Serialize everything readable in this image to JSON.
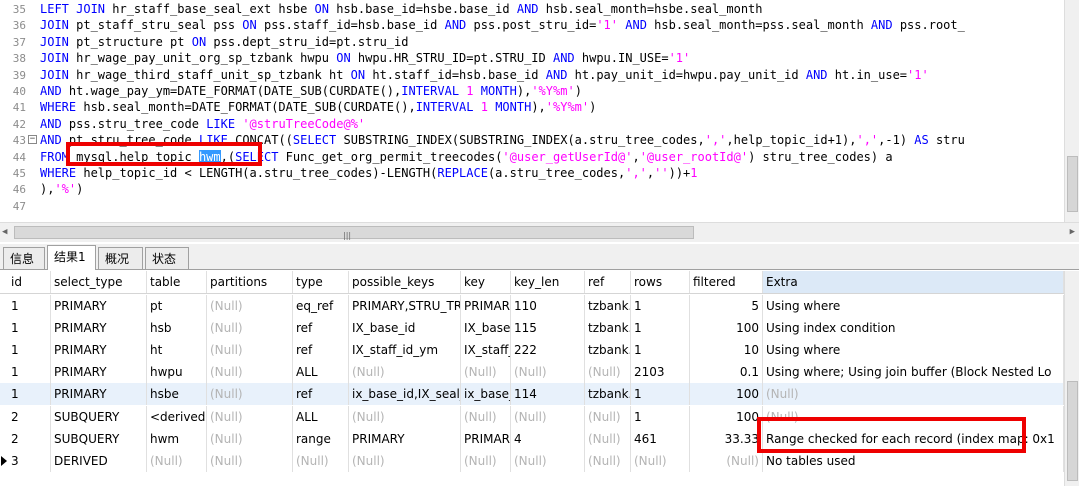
{
  "editor": {
    "lines": [
      {
        "n": "35",
        "fold": false,
        "segs": [
          {
            "t": "LEFT JOIN",
            "c": "kw"
          },
          {
            "t": " hr_staff_base_seal_ext hsbe "
          },
          {
            "t": "ON",
            "c": "kw"
          },
          {
            "t": " hsb.base_id=hsbe.base_id "
          },
          {
            "t": "AND",
            "c": "kw"
          },
          {
            "t": " hsb.seal_month=hsbe.seal_month"
          }
        ]
      },
      {
        "n": "36",
        "fold": false,
        "segs": [
          {
            "t": "JOIN",
            "c": "kw"
          },
          {
            "t": " pt_staff_stru_seal pss "
          },
          {
            "t": "ON",
            "c": "kw"
          },
          {
            "t": " pss.staff_id=hsb.base_id "
          },
          {
            "t": "AND",
            "c": "kw"
          },
          {
            "t": " pss.post_stru_id="
          },
          {
            "t": "'1'",
            "c": "str"
          },
          {
            "t": " "
          },
          {
            "t": "AND",
            "c": "kw"
          },
          {
            "t": " hsb.seal_month=pss.seal_month "
          },
          {
            "t": "AND",
            "c": "kw"
          },
          {
            "t": " pss.root_"
          }
        ]
      },
      {
        "n": "37",
        "fold": false,
        "segs": [
          {
            "t": "JOIN",
            "c": "kw"
          },
          {
            "t": " pt_structure pt "
          },
          {
            "t": "ON",
            "c": "kw"
          },
          {
            "t": " pss.dept_stru_id=pt.stru_id"
          }
        ]
      },
      {
        "n": "38",
        "fold": false,
        "segs": [
          {
            "t": "JOIN",
            "c": "kw"
          },
          {
            "t": " hr_wage_pay_unit_org_sp_tzbank hwpu "
          },
          {
            "t": "ON",
            "c": "kw"
          },
          {
            "t": " hwpu.HR_STRU_ID=pt.STRU_ID "
          },
          {
            "t": "AND",
            "c": "kw"
          },
          {
            "t": " hwpu.IN_USE="
          },
          {
            "t": "'1'",
            "c": "str"
          }
        ]
      },
      {
        "n": "39",
        "fold": false,
        "segs": [
          {
            "t": "JOIN",
            "c": "kw"
          },
          {
            "t": " hr_wage_third_staff_unit_sp_tzbank ht "
          },
          {
            "t": "ON",
            "c": "kw"
          },
          {
            "t": " ht.staff_id=hsb.base_id "
          },
          {
            "t": "AND",
            "c": "kw"
          },
          {
            "t": " ht.pay_unit_id=hwpu.pay_unit_id "
          },
          {
            "t": "AND",
            "c": "kw"
          },
          {
            "t": " ht.in_use="
          },
          {
            "t": "'1'",
            "c": "str"
          }
        ]
      },
      {
        "n": "40",
        "fold": false,
        "segs": [
          {
            "t": "AND",
            "c": "kw"
          },
          {
            "t": " ht.wage_pay_ym=DATE_FORMAT(DATE_SUB(CURDATE(),"
          },
          {
            "t": "INTERVAL",
            "c": "kw"
          },
          {
            "t": " "
          },
          {
            "t": "1",
            "c": "num"
          },
          {
            "t": " "
          },
          {
            "t": "MONTH",
            "c": "kw"
          },
          {
            "t": "),"
          },
          {
            "t": "'%Y%m'",
            "c": "str"
          },
          {
            "t": ")"
          }
        ]
      },
      {
        "n": "41",
        "fold": false,
        "segs": [
          {
            "t": "WHERE",
            "c": "kw"
          },
          {
            "t": " hsb.seal_month=DATE_FORMAT(DATE_SUB(CURDATE(),"
          },
          {
            "t": "INTERVAL",
            "c": "kw"
          },
          {
            "t": " "
          },
          {
            "t": "1",
            "c": "num"
          },
          {
            "t": " "
          },
          {
            "t": "MONTH",
            "c": "kw"
          },
          {
            "t": "),"
          },
          {
            "t": "'%Y%m'",
            "c": "str"
          },
          {
            "t": ")"
          }
        ]
      },
      {
        "n": "42",
        "fold": false,
        "segs": [
          {
            "t": "AND",
            "c": "kw"
          },
          {
            "t": " pss.stru_tree_code "
          },
          {
            "t": "LIKE",
            "c": "kw"
          },
          {
            "t": " "
          },
          {
            "t": "'@struTreeCode@%'",
            "c": "str"
          }
        ]
      },
      {
        "n": "43",
        "fold": true,
        "segs": [
          {
            "t": "AND",
            "c": "kw"
          },
          {
            "t": " pt.stru_tree_code "
          },
          {
            "t": "LIKE",
            "c": "kw"
          },
          {
            "t": " CONCAT(("
          },
          {
            "t": "SELECT",
            "c": "kw"
          },
          {
            "t": " SUBSTRING_INDEX(SUBSTRING_INDEX(a.stru_tree_codes,"
          },
          {
            "t": "','",
            "c": "str"
          },
          {
            "t": ",help_topic_id+1),"
          },
          {
            "t": "','",
            "c": "str"
          },
          {
            "t": ",-1) "
          },
          {
            "t": "AS",
            "c": "kw"
          },
          {
            "t": " stru"
          }
        ]
      },
      {
        "n": "44",
        "fold": false,
        "segs": [
          {
            "t": "FROM",
            "c": "kw"
          },
          {
            "t": " mysql.help_topic "
          },
          {
            "t": "hwm",
            "c": "sel"
          },
          {
            "t": ",("
          },
          {
            "t": "SELECT",
            "c": "kw"
          },
          {
            "t": " Func_get_org_permit_treecodes("
          },
          {
            "t": "'@user_getUserId@'",
            "c": "str"
          },
          {
            "t": ","
          },
          {
            "t": "'@user_rootId@'",
            "c": "str"
          },
          {
            "t": ") stru_tree_codes) a"
          }
        ]
      },
      {
        "n": "45",
        "fold": false,
        "segs": [
          {
            "t": "WHERE",
            "c": "kw"
          },
          {
            "t": " help_topic_id < LENGTH(a.stru_tree_codes)-LENGTH("
          },
          {
            "t": "REPLACE",
            "c": "kw"
          },
          {
            "t": "(a.stru_tree_codes,"
          },
          {
            "t": "','",
            "c": "str"
          },
          {
            "t": ","
          },
          {
            "t": "''",
            "c": "str"
          },
          {
            "t": "))+"
          },
          {
            "t": "1",
            "c": "num"
          }
        ]
      },
      {
        "n": "46",
        "fold": false,
        "segs": [
          {
            "t": "),"
          },
          {
            "t": "'%'",
            "c": "str"
          },
          {
            "t": ")"
          }
        ]
      },
      {
        "n": "47",
        "fold": false,
        "segs": []
      }
    ]
  },
  "tabs": [
    {
      "label": "信息",
      "active": false
    },
    {
      "label": "结果1",
      "active": true
    },
    {
      "label": "概况",
      "active": false
    },
    {
      "label": "状态",
      "active": false
    }
  ],
  "grid": {
    "columns": [
      "id",
      "select_type",
      "table",
      "partitions",
      "type",
      "possible_keys",
      "key",
      "key_len",
      "ref",
      "rows",
      "filtered",
      "Extra"
    ],
    "rows": [
      [
        "1",
        "PRIMARY",
        "pt",
        "(Null)",
        "eq_ref",
        "PRIMARY,STRU_TR",
        "PRIMAR",
        "110",
        "tzbank.",
        "1",
        "5",
        "Using where"
      ],
      [
        "1",
        "PRIMARY",
        "hsb",
        "(Null)",
        "ref",
        "IX_base_id",
        "IX_base_",
        "115",
        "tzbank.",
        "1",
        "100",
        "Using index condition"
      ],
      [
        "1",
        "PRIMARY",
        "ht",
        "(Null)",
        "ref",
        "IX_staff_id_ym",
        "IX_staff_",
        "222",
        "tzbank.",
        "1",
        "10",
        "Using where"
      ],
      [
        "1",
        "PRIMARY",
        "hwpu",
        "(Null)",
        "ALL",
        "(Null)",
        "(Null)",
        "(Null)",
        "(Null)",
        "2103",
        "0.1",
        "Using where; Using join buffer (Block Nested Lo"
      ],
      [
        "1",
        "PRIMARY",
        "hsbe",
        "(Null)",
        "ref",
        "ix_base_id,IX_seal_",
        "ix_base_",
        "114",
        "tzbank.",
        "1",
        "100",
        "(Null)"
      ],
      [
        "2",
        "SUBQUERY",
        "<derived3",
        "(Null)",
        "ALL",
        "(Null)",
        "(Null)",
        "(Null)",
        "(Null)",
        "1",
        "100",
        "(Null)"
      ],
      [
        "2",
        "SUBQUERY",
        "hwm",
        "(Null)",
        "range",
        "PRIMARY",
        "PRIMAR",
        "4",
        "(Null)",
        "461",
        "33.33",
        "Range checked for each record (index map: 0x1"
      ],
      [
        "3",
        "DERIVED",
        "(Null)",
        "(Null)",
        "(Null)",
        "(Null)",
        "(Null)",
        "(Null)",
        "(Null)",
        "(Null)",
        "(Null)",
        "No tables used"
      ]
    ],
    "selected_row": 4,
    "current_row": 7
  },
  "colors": {
    "keyword": "#0000ff",
    "string": "#ff00ff",
    "highlight": "#ee0000",
    "selection": "#3399ff"
  }
}
